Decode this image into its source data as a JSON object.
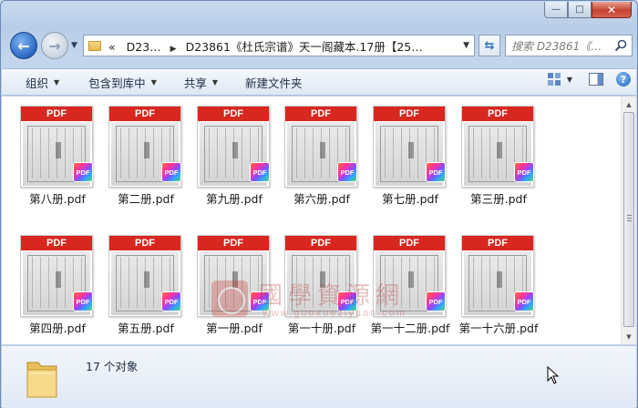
{
  "window": {
    "minimize_symbol": "—",
    "maximize_symbol": "□",
    "close_symbol": "✕"
  },
  "address_bar": {
    "root_crumb": "D23…",
    "current_crumb": "D23861《杜氏宗谱》天一阁藏本.17册【25…",
    "overflow_symbol": "«"
  },
  "search": {
    "placeholder": "搜索 D23861《…"
  },
  "toolbar": {
    "organize": "组织",
    "include_in_library": "包含到库中",
    "share": "共享",
    "new_folder": "新建文件夹"
  },
  "files": [
    {
      "name": "第八册.pdf",
      "band": "PDF",
      "badge": "PDF"
    },
    {
      "name": "第二册.pdf",
      "band": "PDF",
      "badge": "PDF"
    },
    {
      "name": "第九册.pdf",
      "band": "PDF",
      "badge": "PDF"
    },
    {
      "name": "第六册.pdf",
      "band": "PDF",
      "badge": "PDF"
    },
    {
      "name": "第七册.pdf",
      "band": "PDF",
      "badge": "PDF"
    },
    {
      "name": "第三册.pdf",
      "band": "PDF",
      "badge": "PDF"
    },
    {
      "name": "第四册.pdf",
      "band": "PDF",
      "badge": "PDF"
    },
    {
      "name": "第五册.pdf",
      "band": "PDF",
      "badge": "PDF"
    },
    {
      "name": "第一册.pdf",
      "band": "PDF",
      "badge": "PDF"
    },
    {
      "name": "第一十册.pdf",
      "band": "PDF",
      "badge": "PDF"
    },
    {
      "name": "第一十二册.pdf",
      "band": "PDF",
      "badge": "PDF"
    },
    {
      "name": "第一十六册.pdf",
      "band": "PDF",
      "badge": "PDF"
    }
  ],
  "watermark": {
    "text": "國學資源網",
    "url": "www.guoxueziyuan.com"
  },
  "details": {
    "item_count": "17 个对象"
  },
  "colors": {
    "pdf_band": "#d8271f",
    "accent_blue": "#2a68c3"
  }
}
